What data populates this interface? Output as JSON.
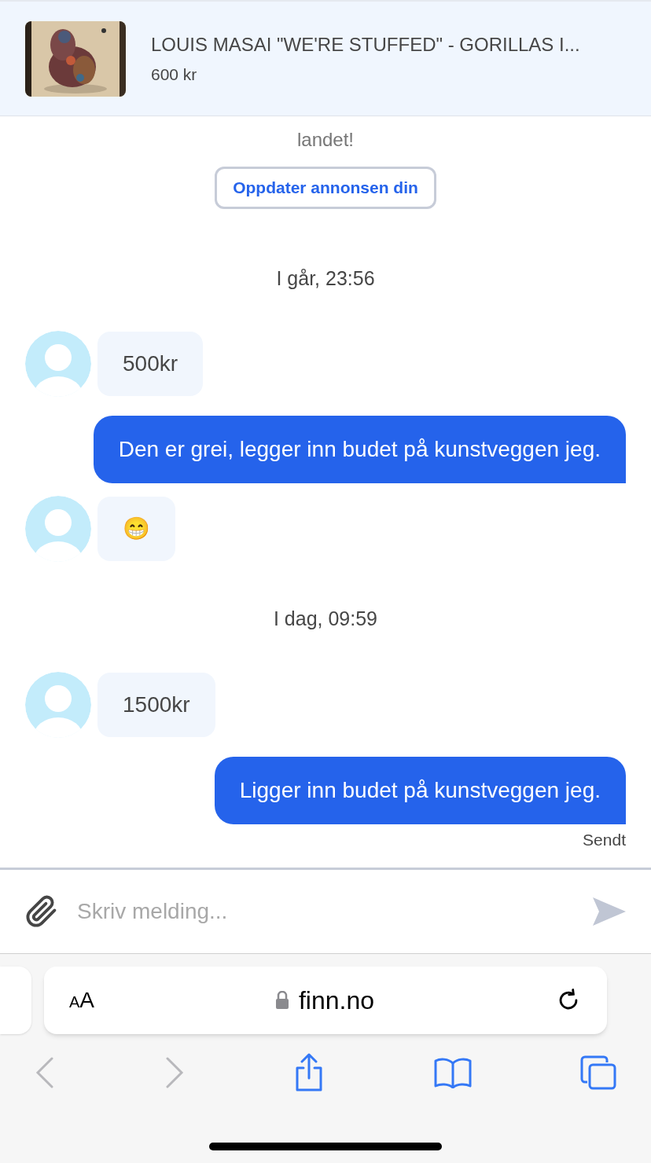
{
  "listing": {
    "title": "LOUIS MASAI \"WE'RE STUFFED\" - GORILLAS I...",
    "price": "600 kr",
    "kind": "picture"
  },
  "notice": {
    "text": "landet!",
    "button": "Oppdater annonsen din"
  },
  "messages": [
    {
      "kind": "time",
      "text": "I går, 23:56"
    },
    {
      "kind": "in",
      "text": "500kr"
    },
    {
      "kind": "out",
      "text": "Den er grei, legger inn budet på kunstveggen jeg."
    },
    {
      "kind": "in",
      "text": "😁"
    },
    {
      "kind": "time",
      "text": "I dag, 09:59"
    },
    {
      "kind": "in",
      "text": "1500kr"
    },
    {
      "kind": "out",
      "text": "Ligger inn budet på kunstveggen jeg.",
      "status": "Sendt"
    }
  ],
  "composer": {
    "placeholder": "Skriv melding..."
  },
  "browser": {
    "text_size": "AA",
    "url": "finn.no"
  }
}
